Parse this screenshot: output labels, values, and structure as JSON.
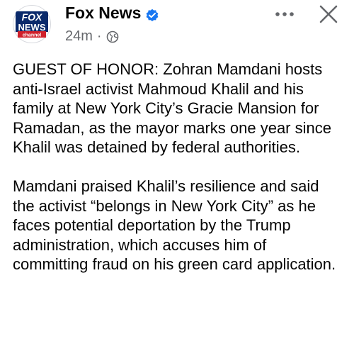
{
  "post": {
    "page_name": "Fox News",
    "avatar_text": [
      "FOX",
      "NEWS",
      "channel"
    ],
    "timestamp": "24m",
    "separator": "·",
    "paragraphs": [
      "GUEST OF HONOR: Zohran Mamdani hosts anti-Israel activist Mahmoud Khalil and his family at New York City’s Gracie Mansion for Ramadan, as the mayor marks one year since Khalil was detained by federal authorities.",
      "Mamdani praised Khalil’s resilience and said the activist “belongs in New York City” as he faces potential deportation by the Trump administration, which accuses him of committing fraud on his green card application."
    ]
  },
  "icons": {
    "verified": "verified-badge-icon",
    "audience": "globe-icon",
    "more": "more-options-icon",
    "close": "close-icon"
  },
  "colors": {
    "verified_blue": "#1877f2",
    "fox_blue": "#0a2a6b",
    "fox_red": "#d0202a",
    "meta_gray": "#65676b"
  }
}
